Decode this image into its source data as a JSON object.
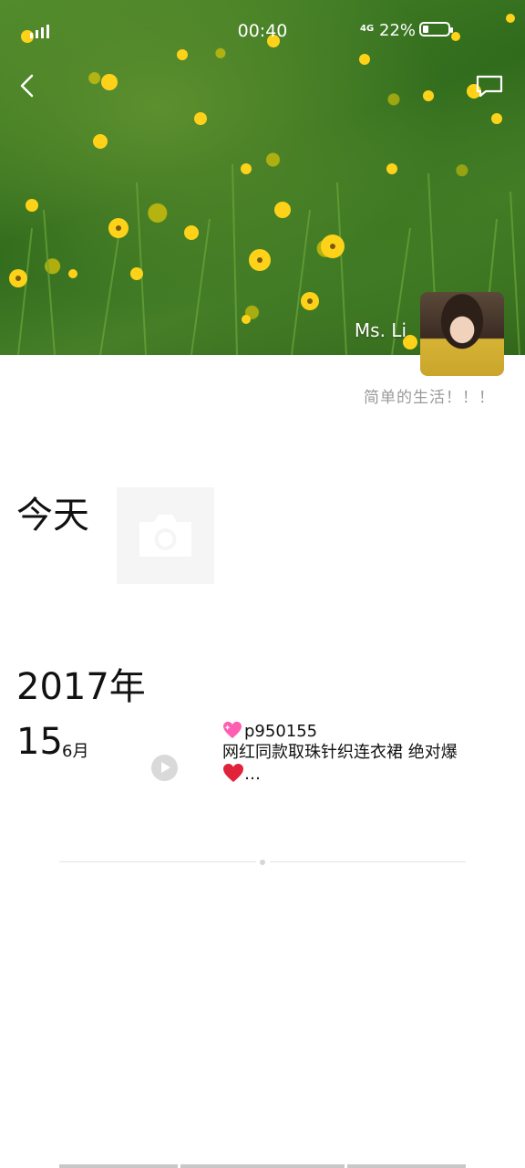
{
  "status_bar": {
    "time": "00:40",
    "network": "4G",
    "battery_percent": "22%",
    "battery_level": 0.22
  },
  "profile": {
    "username": "Ms. Li",
    "signature": "简单的生活！！！"
  },
  "timeline": {
    "today_label": "今天",
    "year_label": "2017年",
    "entry": {
      "day": "15",
      "month": "6月",
      "line1": "p950155",
      "line2": "网红同款取珠针织连衣裙 绝对爆",
      "line3": "…"
    }
  },
  "icons": {
    "back": "back-arrow-icon",
    "messages": "message-icon",
    "camera": "camera-icon",
    "play": "play-icon"
  }
}
